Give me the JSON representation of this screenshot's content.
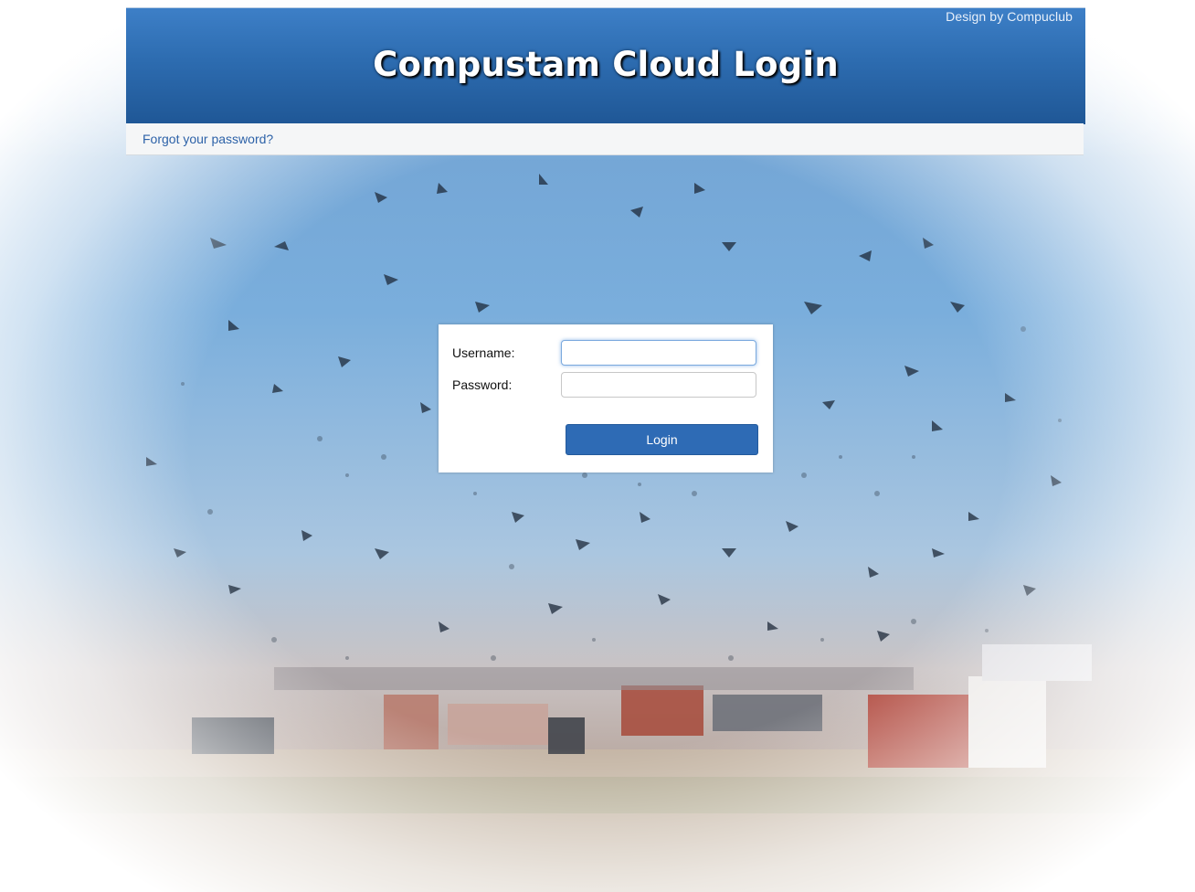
{
  "header": {
    "title": "Compustam Cloud Login",
    "credit": "Design by Compuclub"
  },
  "subbar": {
    "forgot_link": "Forgot your password?"
  },
  "login_form": {
    "username_label": "Username:",
    "password_label": "Password:",
    "username_value": "",
    "password_value": "",
    "login_button": "Login"
  },
  "colors": {
    "header_blue": "#2d6cb0",
    "button_blue": "#2e6bb5",
    "link_blue": "#2d62a8"
  },
  "background": {
    "icon": "pigeon-flock-photo"
  }
}
